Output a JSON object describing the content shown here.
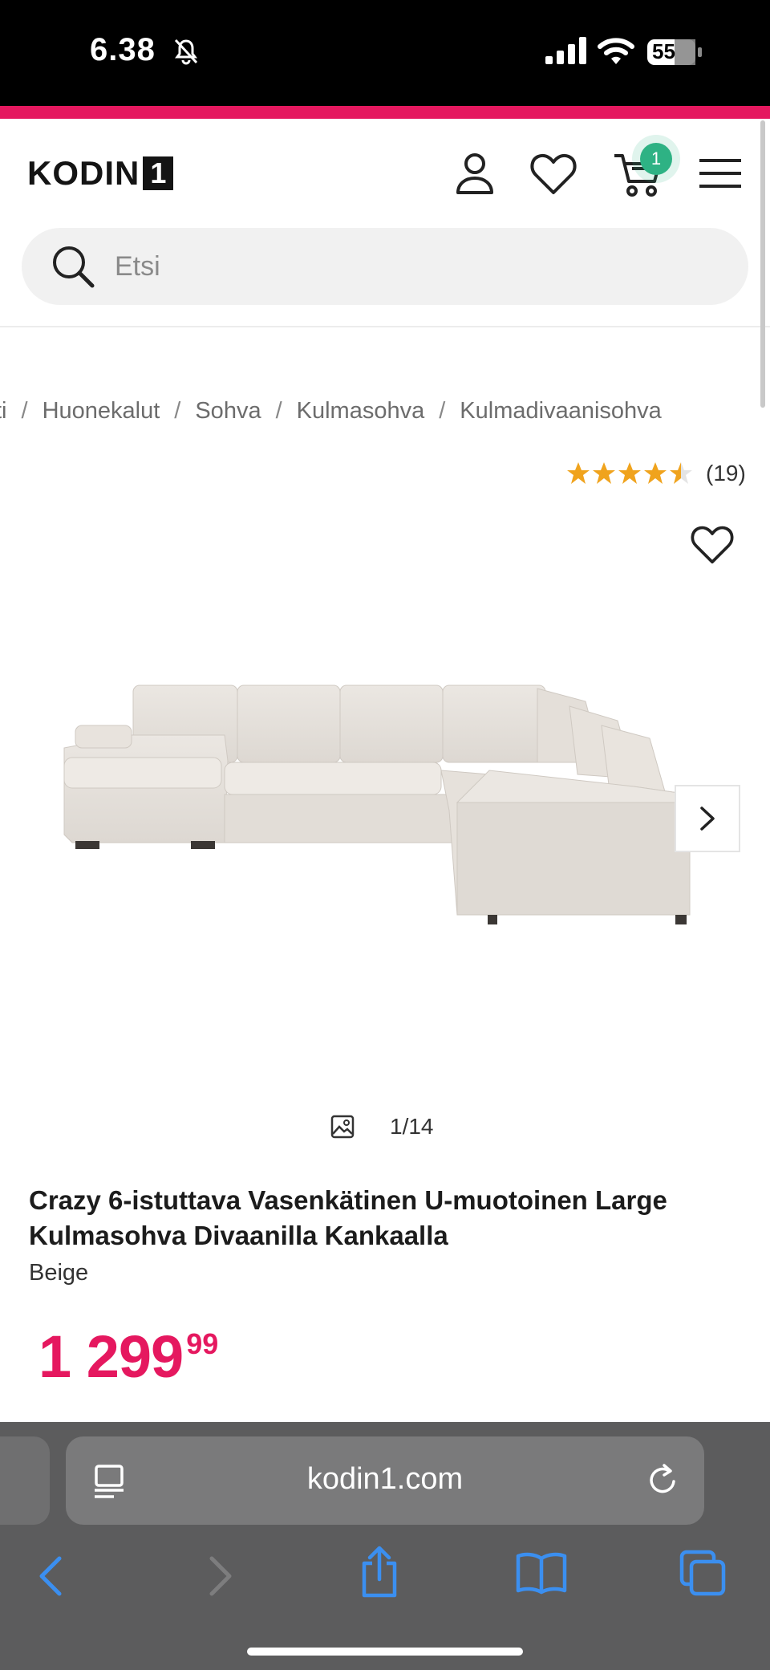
{
  "status_bar": {
    "time": "6.38",
    "battery": "55"
  },
  "header": {
    "logo_word": "KODIN",
    "logo_number": "1",
    "cart_count": "1",
    "search_placeholder": "Etsi"
  },
  "breadcrumb": {
    "items": [
      "ti",
      "Huonekalut",
      "Sohva",
      "Kulmasohva",
      "Kulmadivaanisohva"
    ],
    "separator": "/"
  },
  "rating": {
    "stars": 4.5,
    "max": 5,
    "count": "(19)",
    "star_color": "#f0a31d"
  },
  "gallery": {
    "counter": "1/14"
  },
  "product": {
    "title": "Crazy 6-istuttava Vasenkätinen U-muotoinen Large Kulmasohva Divaanilla Kankaalla",
    "variant": "Beige",
    "price_main": "1 299",
    "price_cents": "99"
  },
  "browser": {
    "url": "kodin1.com"
  },
  "colors": {
    "accent": "#e5185f",
    "cart_badge": "#2eb284",
    "browser_icons": "#3b8ff0"
  }
}
